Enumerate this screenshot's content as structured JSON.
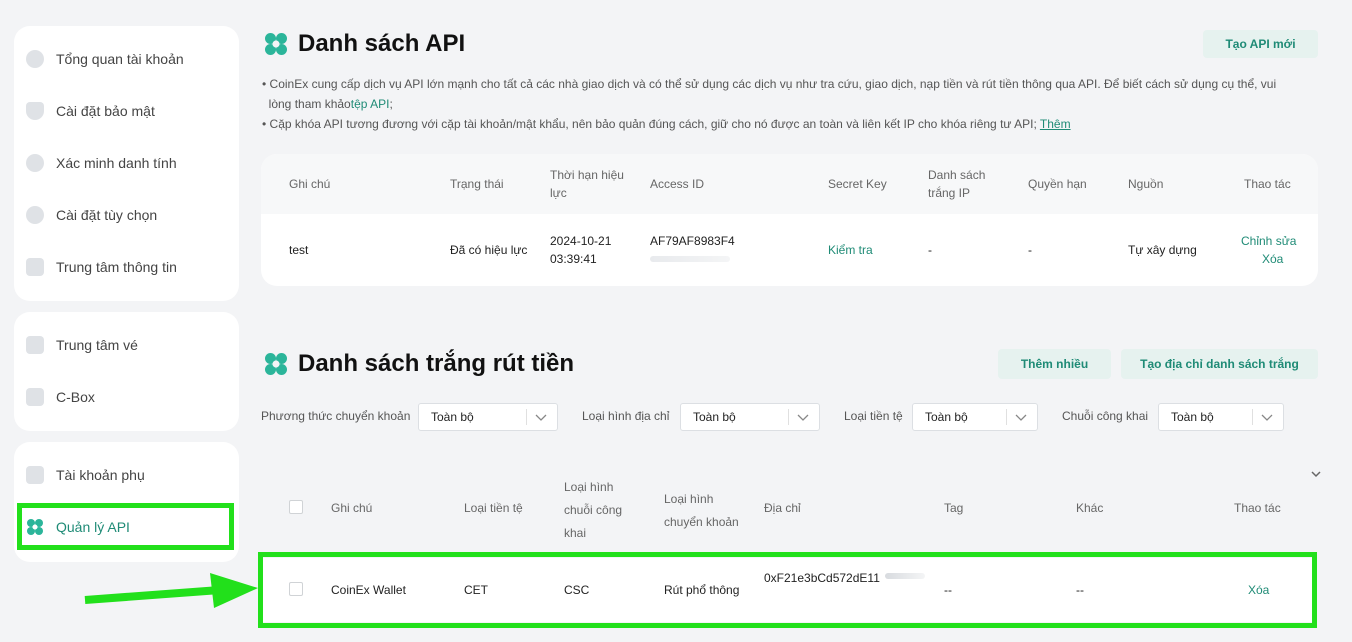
{
  "sidebar": {
    "group1": [
      {
        "label": "Tổng quan tài khoản",
        "icon": "pie-chart-icon"
      },
      {
        "label": "Cài đặt bảo mật",
        "icon": "shield-icon"
      },
      {
        "label": "Xác minh danh tính",
        "icon": "id-verify-icon"
      },
      {
        "label": "Cài đặt tùy chọn",
        "icon": "settings-icon"
      },
      {
        "label": "Trung tâm thông tin",
        "icon": "message-icon"
      }
    ],
    "group2": [
      {
        "label": "Trung tâm vé",
        "icon": "ticket-icon"
      },
      {
        "label": "C-Box",
        "icon": "box-icon"
      }
    ],
    "group3": [
      {
        "label": "Tài khoản phụ",
        "icon": "sub-account-icon"
      },
      {
        "label": "Quản lý API",
        "icon": "api-icon",
        "active": true
      }
    ]
  },
  "api_section": {
    "title": "Danh sách API",
    "create_button": "Tạo API mới",
    "note1_text": "CoinEx cung cấp dịch vụ API lớn mạnh cho tất cả các nhà giao dịch và có thể sử dụng các dịch vụ như tra cứu, giao dịch, nạp tiền và rút tiền thông qua API. Để biết cách sử dụng cụ thể, vui",
    "note1_text2": "lòng tham khảo",
    "note1_link": "tệp API",
    "note1_end": ";",
    "note2_text": "Cặp khóa API tương đương với cặp tài khoản/mật khẩu, nên bảo quản đúng cách, giữ cho nó được an toàn và liên kết IP cho khóa riêng tư API;",
    "note2_link": "Thêm",
    "headers": {
      "note": "Ghi chú",
      "status": "Trạng thái",
      "expiry_1": "Thời hạn hiệu",
      "expiry_2": "lực",
      "access_id": "Access ID",
      "secret_key": "Secret Key",
      "whitelist_1": "Danh sách",
      "whitelist_2": "trắng IP",
      "permission": "Quyền hạn",
      "source": "Nguồn",
      "action": "Thao tác"
    },
    "row": {
      "note": "test",
      "status": "Đã có hiệu lực",
      "date": "2024-10-21",
      "time": "03:39:41",
      "access_id": "AF79AF8983F4",
      "secret_key": "Kiểm tra",
      "whitelist": "-",
      "permission": "-",
      "source": "Tự xây dựng",
      "edit": "Chỉnh sửa",
      "delete": "Xóa"
    }
  },
  "withdraw_section": {
    "title": "Danh sách trắng rút tiền",
    "add_multiple": "Thêm nhiều",
    "create_whitelist": "Tạo địa chỉ danh sách trắng",
    "filters": [
      {
        "label": "Phương thức chuyển khoản",
        "value": "Toàn bộ"
      },
      {
        "label": "Loại hình địa chỉ",
        "value": "Toàn bộ"
      },
      {
        "label": "Loại tiền tệ",
        "value": "Toàn bộ"
      },
      {
        "label": "Chuỗi công khai",
        "value": "Toàn bộ"
      }
    ],
    "headers": {
      "note": "Ghi chú",
      "currency": "Loại tiền tệ",
      "chain_1": "Loại hình",
      "chain_2": "chuỗi công",
      "chain_3": "khai",
      "transfer_1": "Loại hình",
      "transfer_2": "chuyển khoản",
      "address": "Địa chỉ",
      "tag": "Tag",
      "other": "Khác",
      "action": "Thao tác"
    },
    "row": {
      "note": "CoinEx Wallet",
      "currency": "CET",
      "chain": "CSC",
      "transfer": "Rút phổ thông",
      "address": "0xF21e3bCd572dE11",
      "tag": "--",
      "other": "--",
      "delete": "Xóa"
    }
  },
  "colors": {
    "accent": "#1f8b76",
    "highlight": "#22e01b"
  }
}
